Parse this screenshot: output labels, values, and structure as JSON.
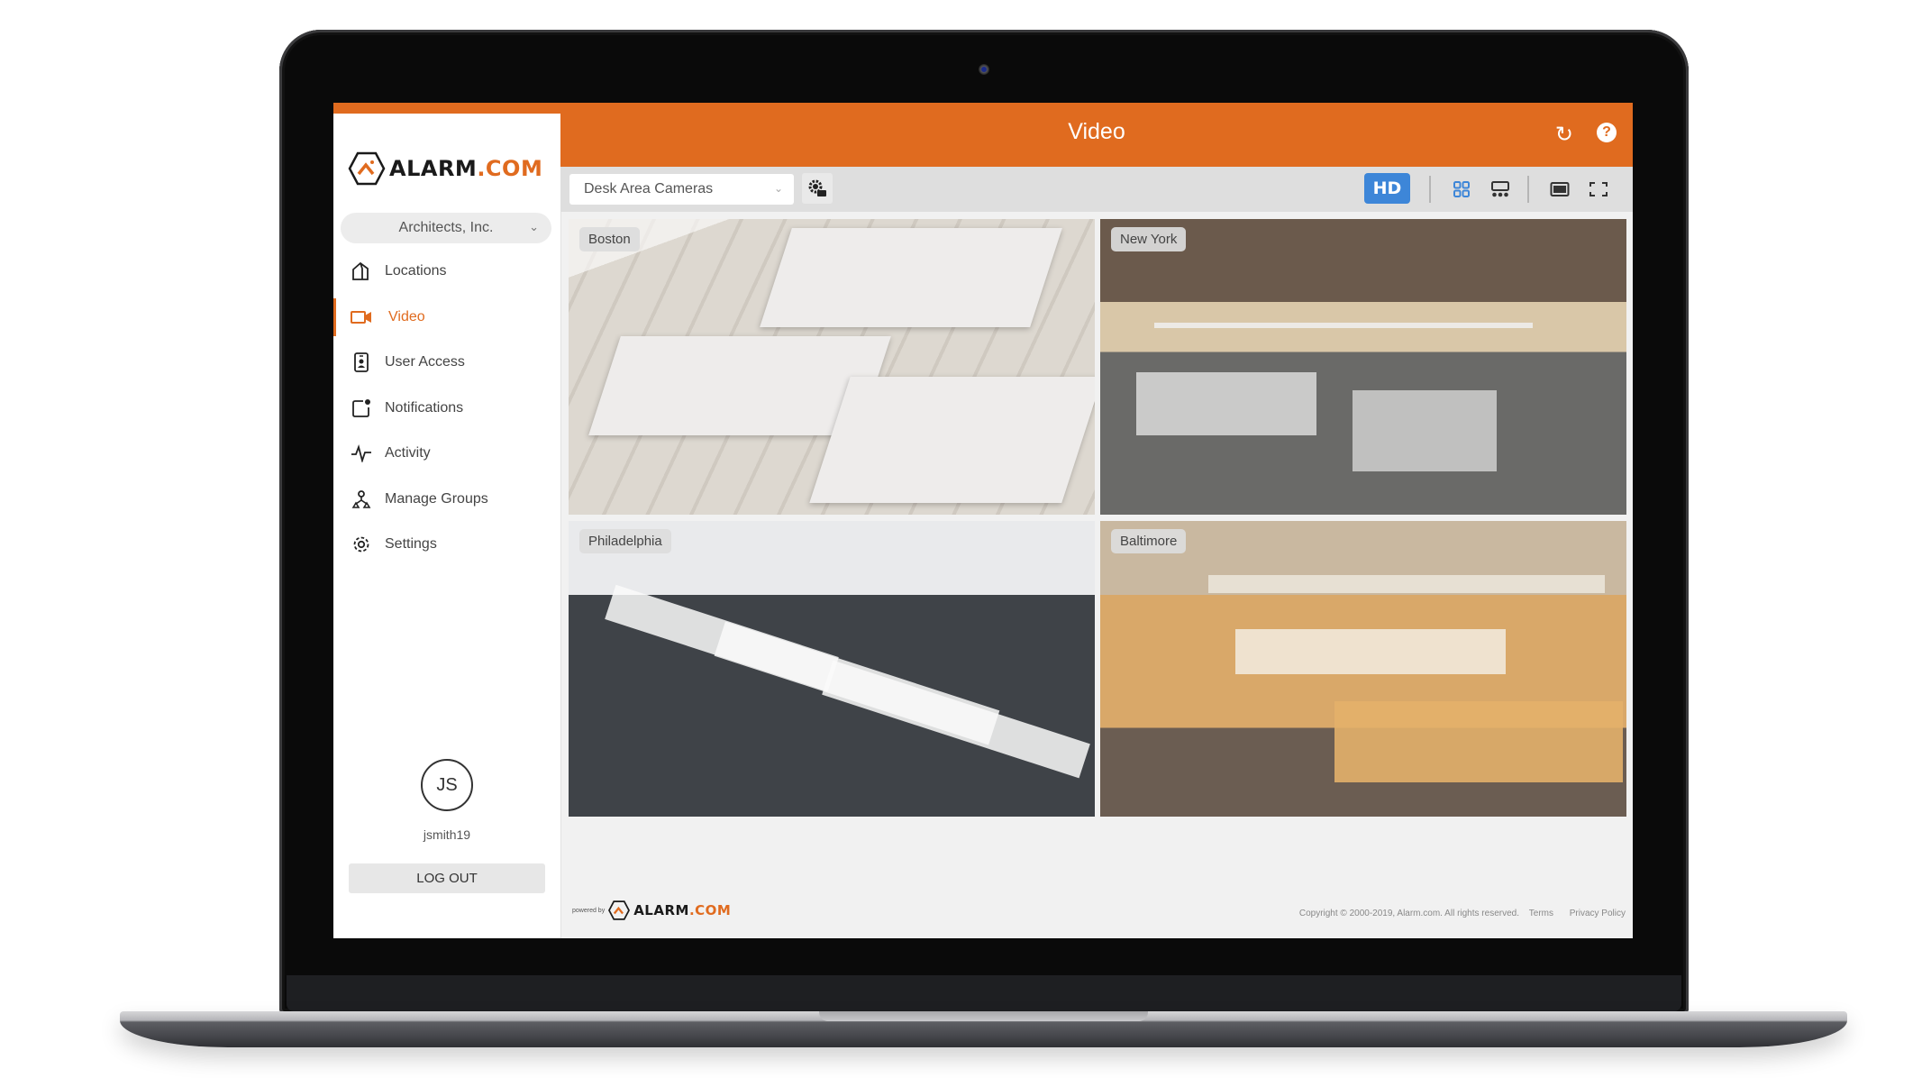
{
  "brand": {
    "name": "ALARM",
    "tld": ".COM",
    "accent": "#e06b1f",
    "highlight": "#3d86d8"
  },
  "sidebar": {
    "org_selector": {
      "value": "Architects, Inc.",
      "icon": "chevron-down-icon"
    },
    "items": [
      {
        "label": "Locations",
        "icon": "house-icon",
        "active": false
      },
      {
        "label": "Video",
        "icon": "video-camera-icon",
        "active": true
      },
      {
        "label": "User Access",
        "icon": "id-badge-icon",
        "active": false
      },
      {
        "label": "Notifications",
        "icon": "notification-icon",
        "active": false
      },
      {
        "label": "Activity",
        "icon": "pulse-icon",
        "active": false
      },
      {
        "label": "Manage Groups",
        "icon": "hierarchy-icon",
        "active": false
      },
      {
        "label": "Settings",
        "icon": "gear-icon",
        "active": false
      }
    ],
    "user": {
      "initials": "JS",
      "username": "jsmith19"
    },
    "logout_label": "LOG OUT"
  },
  "header": {
    "title": "Video",
    "refresh_icon": "refresh-icon",
    "help_icon": "help-icon",
    "help_glyph": "?"
  },
  "toolbar": {
    "camera_group": {
      "value": "Desk Area Cameras",
      "icon": "chevron-down-icon"
    },
    "group_settings_icon": "gear-folder-icon",
    "hd_label": "HD",
    "layout_buttons": [
      "grid-2x2-icon",
      "grid-1plus3-icon",
      "single-view-icon",
      "fullscreen-icon"
    ]
  },
  "cameras": [
    {
      "label": "Boston"
    },
    {
      "label": "New York"
    },
    {
      "label": "Philadelphia"
    },
    {
      "label": "Baltimore"
    }
  ],
  "footer": {
    "powered_by": "powered by",
    "copyright": "Copyright © 2000-2019, Alarm.com. All rights reserved.",
    "terms": "Terms",
    "privacy": "Privacy Policy"
  }
}
